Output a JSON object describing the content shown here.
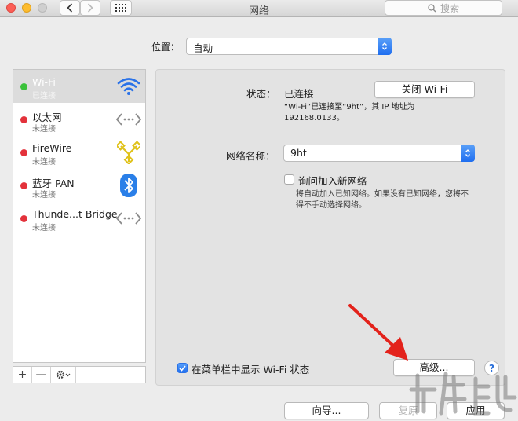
{
  "window": {
    "title": "网络"
  },
  "toolbar": {
    "search_placeholder": "搜索"
  },
  "location": {
    "label": "位置：",
    "value": "自动"
  },
  "services": [
    {
      "name": "Wi-Fi",
      "status": "已连接",
      "dot_color": "#3ac13a",
      "icon": "wifi-icon",
      "selected": true
    },
    {
      "name": "以太网",
      "status": "未连接",
      "dot_color": "#e3323b",
      "icon": "ethernet-icon",
      "selected": false
    },
    {
      "name": "FireWire",
      "status": "未连接",
      "dot_color": "#e3323b",
      "icon": "firewire-icon",
      "selected": false
    },
    {
      "name": "蓝牙 PAN",
      "status": "未连接",
      "dot_color": "#e3323b",
      "icon": "bluetooth-icon",
      "selected": false
    },
    {
      "name": "Thunde...t Bridge",
      "status": "未连接",
      "dot_color": "#e3323b",
      "icon": "thunderbolt-bridge-icon",
      "selected": false
    }
  ],
  "sidebar_tools": {
    "add": "+",
    "remove": "—"
  },
  "detail": {
    "status_label": "状态：",
    "status_value": "已连接",
    "toggle_button": "关闭 Wi-Fi",
    "status_note_1": "“Wi-Fi”已连接至“9ht”，其 IP 地址为",
    "status_note_2": "192168.0133。",
    "network_name_label": "网络名称：",
    "network_name_value": "9ht",
    "ask_join_label": "询问加入新网络",
    "ask_join_note_1": "将自动加入已知网络。如果没有已知网络，您将不",
    "ask_join_note_2": "得不手动选择网络。",
    "menubar_label": "在菜单栏中显示 Wi-Fi 状态",
    "advanced_button": "高级...",
    "help": "?"
  },
  "footer": {
    "assist": "向导...",
    "revert": "复原",
    "apply": "应用"
  },
  "colors": {
    "accent": "#2a72e8",
    "selected_row": "#dcdcdc",
    "arrow": "#e3221b"
  }
}
